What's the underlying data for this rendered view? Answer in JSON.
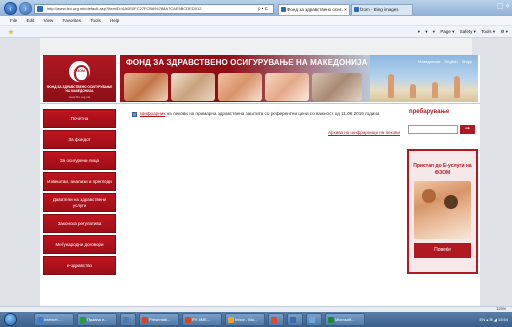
{
  "browser": {
    "address": "http://www.fzo.org.mk/default.asp?ItemID=6A0E0FC27FCB694788A7CAE9BCDED012",
    "addr_tools": "ρ • C",
    "tabs": [
      {
        "label": "Фонд за здравствено осиг...",
        "close": "×",
        "icon_color": "#2a6ab7"
      },
      {
        "label": "fzom - Bing images",
        "icon_color": "#2a6ab7"
      }
    ],
    "window_controls": "▢ ⟡",
    "menu": [
      "File",
      "Edit",
      "View",
      "Favorites",
      "Tools",
      "Help"
    ],
    "cmd_items": [
      "▾",
      "▾",
      "▾",
      "Page ▾",
      "Safety ▾",
      "Tools ▾",
      "⚙ ▾"
    ],
    "zoom": "125%"
  },
  "site": {
    "logo_label": "ФЗОМ",
    "logo_text": "ФОНД ЗА ЗДРАВСТВЕНО ОСИГУРУВАЊЕ НА МАКЕДОНИЈА",
    "logo_url": "www.fzo.org.mk",
    "banner_title": "ФОНД ЗА ЗДРАВСТВЕНО ОСИГУРУВАЊЕ НА МАКЕДОНИЈА",
    "banner_links": [
      "Македонски",
      "English",
      "Shqip"
    ],
    "sidebar": [
      "Почетна",
      "За фондот",
      "За осигурени лица",
      "Извештаи, анализи и прегледи",
      "Даватели на здравствени услуги",
      "Законска регулатива",
      "Меѓународни договори",
      "е-здравство"
    ],
    "news": {
      "link": "Шифрарник",
      "text": " на лекови на примарна здравствена заштита со референтни цени со важност од 11.06.2016 година"
    },
    "archive": "Архива на шифрарници на лекови",
    "search": {
      "heading": "пребарување",
      "button": "➞"
    },
    "eservices": {
      "title": "Пристап до Е-услуги на ФЗОМ",
      "button": "Повеќе"
    }
  },
  "taskbar": {
    "buttons": [
      {
        "label": "Internet...",
        "color": "#3b7bd4"
      },
      {
        "label": "Правна п...",
        "color": "#2a9a3a"
      },
      {
        "label": "",
        "color": "#4a7ab0"
      },
      {
        "label": "Presentati...",
        "color": "#d24726"
      },
      {
        "label": "FH 4ME...",
        "color": "#d24726"
      },
      {
        "label": "Inbox - Mo...",
        "color": "#f0a030"
      },
      {
        "label": "",
        "color": "#e04a2a"
      },
      {
        "label": "",
        "color": "#3a6ab0"
      },
      {
        "label": "",
        "color": "#6aa8e0"
      },
      {
        "label": "Microsoft...",
        "color": "#1d8a3a"
      }
    ],
    "tray": "EN ▴ ✉ ◢ 15:54"
  }
}
